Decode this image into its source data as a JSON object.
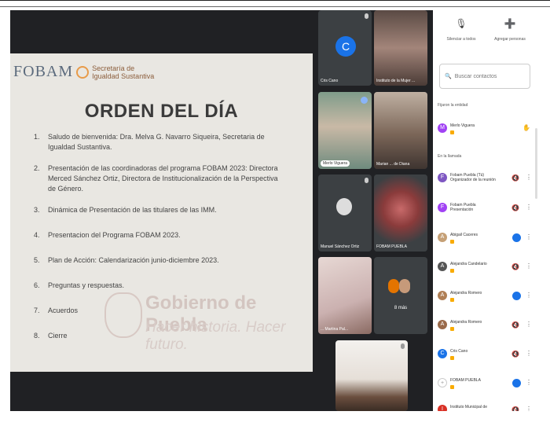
{
  "slide": {
    "logo_text": "FOBAM",
    "logo_subtitle": "Secretaría de Igualdad Sustantiva",
    "title": "ORDEN DEL DÍA",
    "items": [
      {
        "n": "1.",
        "text": "Saludo de bienvenida: Dra. Melva G. Navarro Siqueira, Secretaria de Igualdad Sustantiva."
      },
      {
        "n": "2.",
        "text": "Presentación de las coordinadoras del programa FOBAM 2023: Directora Merced Sánchez Ortiz, Directora de Institucionalización de la Perspectiva de Género."
      },
      {
        "n": "3.",
        "text": "Dinámica de Presentación de las titulares de las IMM."
      },
      {
        "n": "4.",
        "text": "Presentacion del Programa FOBAM 2023."
      },
      {
        "n": "5.",
        "text": "Plan de Acción: Calendarización junio-diciembre 2023."
      },
      {
        "n": "6.",
        "text": "Preguntas y respuestas."
      },
      {
        "n": "7.",
        "text": "Acuerdos"
      },
      {
        "n": "8.",
        "text": "Cierre"
      }
    ],
    "watermark_line1": "Gobierno de Puebla",
    "watermark_line2": "Hacer historia. Hacer futuro."
  },
  "tiles": {
    "t1_name": "Cris Cano",
    "t1_initial": "C",
    "t2_name": "Instituto de la Mujer ...",
    "t3_name": "Merlo Viguera",
    "t4_name": "Marian ... de Diana",
    "t5_name": "Manuel Sánchez Ortiz",
    "t6_name": "FOBAM PUEBLA",
    "t7_name": "... Martina Pal...",
    "t8_label": "8 más"
  },
  "panel": {
    "mute_all_label": "Silenciar a todos",
    "add_people_label": "Agregar personas",
    "search_placeholder": "Buscar contactos",
    "section_pinned": "Fijaron la entidad",
    "section_call": "En la llamada",
    "pinned_person": {
      "name": "Merlo Viguera",
      "initial": "M",
      "color": "#a142f4"
    },
    "people": [
      {
        "name": "Fobam Puebla (Tú) Organizador de la reunión",
        "initial": "F",
        "color": "#7e57c2",
        "action": "mic"
      },
      {
        "name": "Fobam Puebla Presentación",
        "initial": "F",
        "color": "#a142f4",
        "action": "mic"
      },
      {
        "name": "Abigail Caceres",
        "initial": "A",
        "color": "#c5a076",
        "action": "blue"
      },
      {
        "name": "Alejandra Candelario",
        "initial": "A",
        "color": "#555555",
        "action": "mic"
      },
      {
        "name": "Alejandra Romero",
        "initial": "A",
        "color": "#b07f55",
        "action": "blue"
      },
      {
        "name": "Alejandra Romero",
        "initial": "A",
        "color": "#9a6a4a",
        "action": "mic"
      },
      {
        "name": "Cris Cano",
        "initial": "C",
        "color": "#1a73e8",
        "action": "mic"
      },
      {
        "name": "FOBAM PUEBLA",
        "initial": "+",
        "color": "#ffffff",
        "action": "blue"
      },
      {
        "name": "Instituto Municipal de",
        "initial": "I",
        "color": "#d93025",
        "action": "mic"
      }
    ],
    "colors": {
      "accent": "#1a73e8",
      "badge": "#f9ab00",
      "background": "#202124"
    }
  }
}
